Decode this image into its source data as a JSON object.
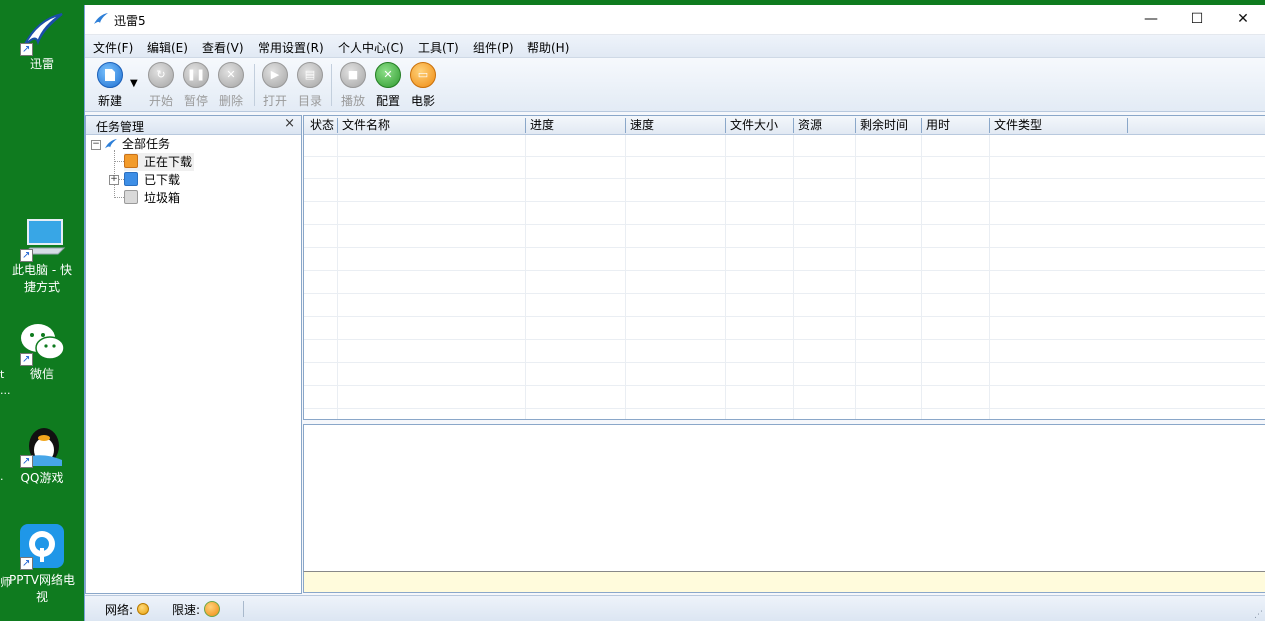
{
  "desktop": {
    "icons": [
      {
        "label": "迅雷"
      },
      {
        "label": "此电脑 - 快\n捷方式"
      },
      {
        "label": "微信"
      },
      {
        "label": "QQ游戏"
      },
      {
        "label": "PPTV网络电\n视"
      }
    ],
    "edge_fragments": [
      "t",
      "...",
      ".",
      "师"
    ]
  },
  "window": {
    "title": "迅雷5",
    "controls": {
      "minimize": "—",
      "maximize": "☐",
      "close": "✕"
    }
  },
  "menu": [
    "文件(F)",
    "编辑(E)",
    "查看(V)",
    "常用设置(R)",
    "个人中心(C)",
    "工具(T)",
    "组件(P)",
    "帮助(H)"
  ],
  "toolbar": {
    "new": "新建",
    "start": "开始",
    "pause": "暂停",
    "delete": "删除",
    "open": "打开",
    "folder": "目录",
    "record": "播放",
    "config": "配置",
    "movie": "电影"
  },
  "task_panel": {
    "title": "任务管理",
    "close": "×",
    "tree": {
      "root": "全部任务",
      "downloading": "正在下载",
      "downloaded": "已下载",
      "trash": "垃圾箱"
    }
  },
  "columns": [
    "状态",
    "文件名称",
    "进度",
    "速度",
    "文件大小",
    "资源",
    "剩余时间",
    "用时",
    "文件类型"
  ],
  "statusbar": {
    "network_label": "网络:",
    "speed_limit_label": "限速:"
  },
  "colors": {
    "accent_blue": "#2d7fd8",
    "config_green": "#3aa83a",
    "movie_orange": "#f19a1c",
    "desktop_green": "#0f7b1f"
  }
}
